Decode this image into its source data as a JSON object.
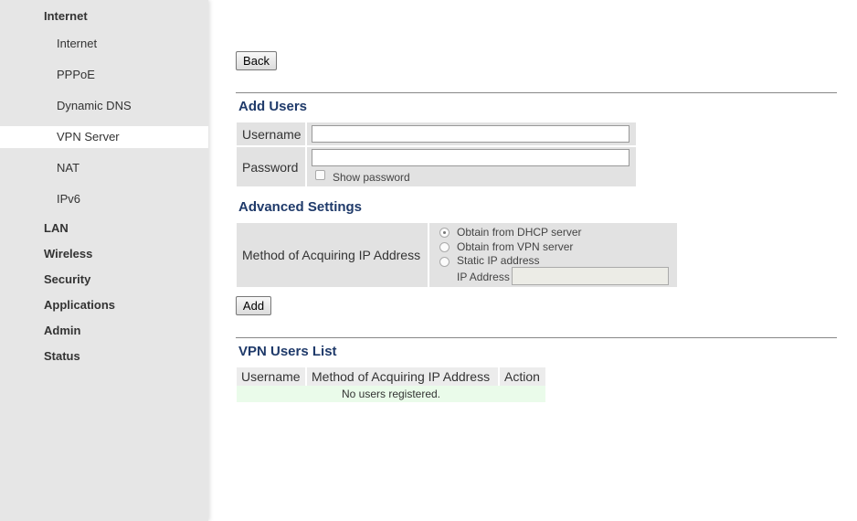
{
  "sidebar": {
    "top_items": [
      {
        "label": "Internet"
      },
      {
        "label": "LAN"
      },
      {
        "label": "Wireless"
      },
      {
        "label": "Security"
      },
      {
        "label": "Applications"
      },
      {
        "label": "Admin"
      },
      {
        "label": "Status"
      }
    ],
    "sub_items": [
      {
        "label": "Internet"
      },
      {
        "label": "PPPoE"
      },
      {
        "label": "Dynamic DNS"
      },
      {
        "label": "VPN Server",
        "active": true
      },
      {
        "label": "NAT"
      },
      {
        "label": "IPv6"
      }
    ]
  },
  "main": {
    "back_label": "Back",
    "add_users": {
      "title": "Add Users",
      "username_label": "Username",
      "username_value": "",
      "password_label": "Password",
      "password_value": "",
      "show_password_label": "Show password",
      "show_password_checked": false
    },
    "advanced": {
      "title": "Advanced Settings",
      "method_label": "Method of Acquiring IP Address",
      "options": [
        {
          "label": "Obtain from DHCP server",
          "checked": true
        },
        {
          "label": "Obtain from VPN server",
          "checked": false
        },
        {
          "label": "Static IP address",
          "checked": false
        }
      ],
      "ip_address_label": "IP Address",
      "ip_address_value": ""
    },
    "add_label": "Add",
    "users_list": {
      "title": "VPN Users List",
      "columns": [
        "Username",
        "Method of Acquiring IP Address",
        "Action"
      ],
      "empty_message": "No users registered."
    }
  },
  "colors": {
    "sidebar_bg": "#e6e6e6",
    "section_title": "#1f3a6a",
    "empty_row_bg": "#eafbea"
  }
}
